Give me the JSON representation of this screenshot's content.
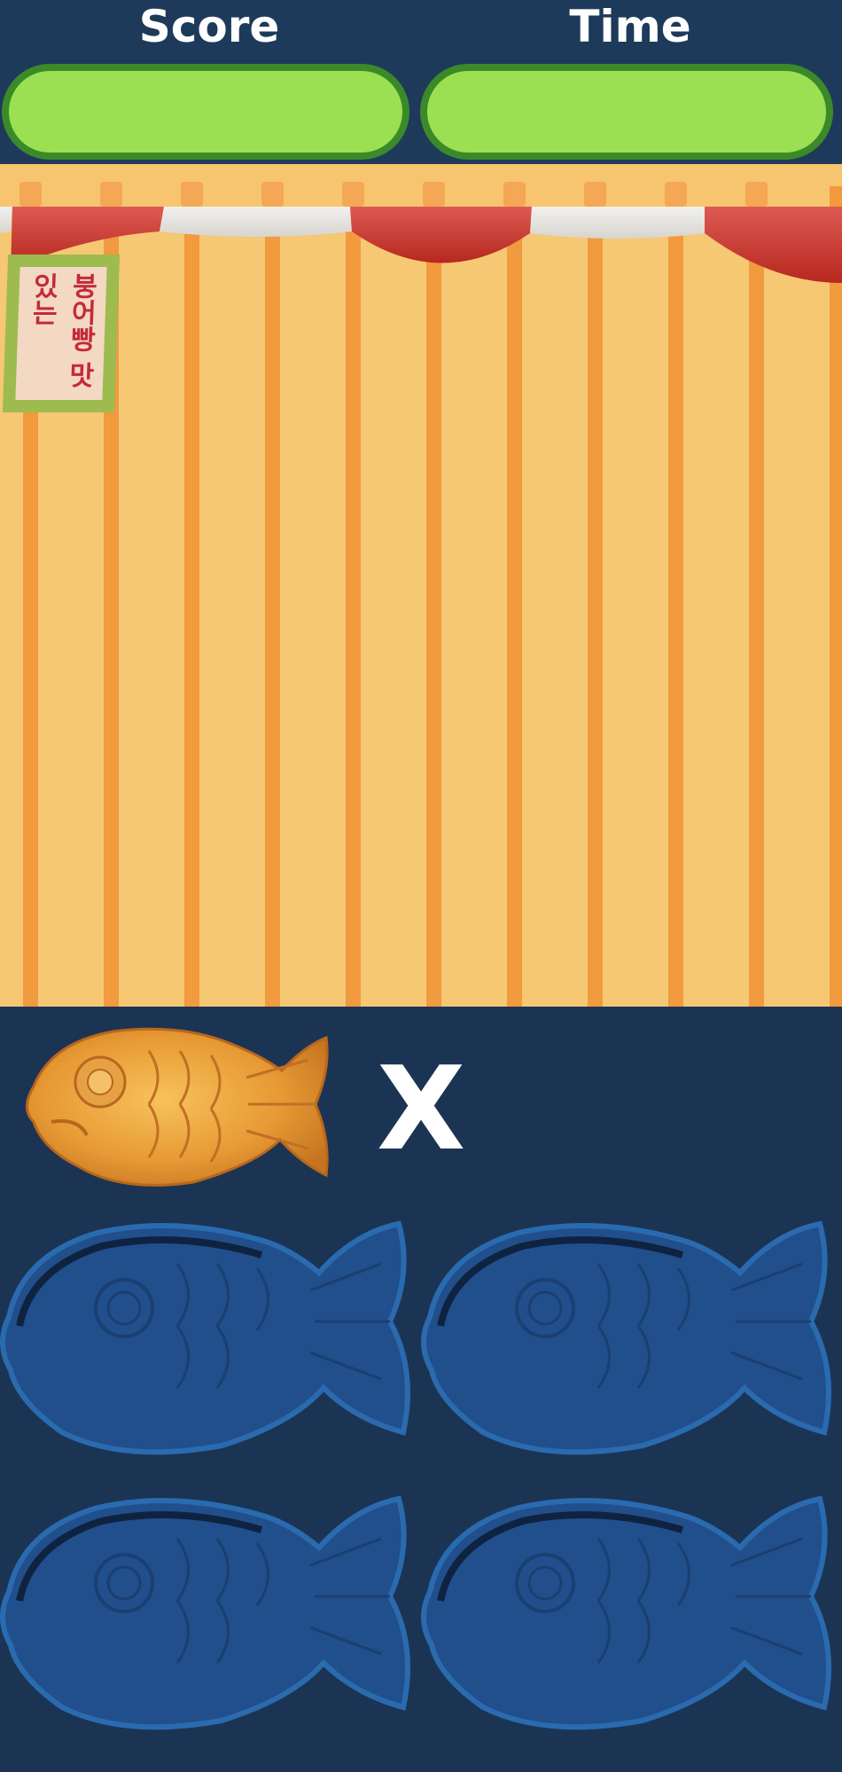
{
  "hud": {
    "score_label": "Score",
    "time_label": "Time"
  },
  "stall": {
    "sign_text": "붕어빵\n맛있는"
  },
  "order": {
    "item_icon": "bungeoppang-icon",
    "multiplier": "X"
  },
  "molds": [
    {
      "name": "mold-1"
    },
    {
      "name": "mold-2"
    },
    {
      "name": "mold-3"
    },
    {
      "name": "mold-4"
    }
  ],
  "colors": {
    "hud_bg": "#1e3a5a",
    "bar_green": "#9be052",
    "bar_border": "#3a8a2a",
    "stall_bg": "#f6c874",
    "pole": "#f19a3e",
    "awning_red": "#c8352c",
    "awning_white": "#e9e7e3",
    "board_bg": "#1c3454",
    "mold_blue": "#214f8c"
  }
}
